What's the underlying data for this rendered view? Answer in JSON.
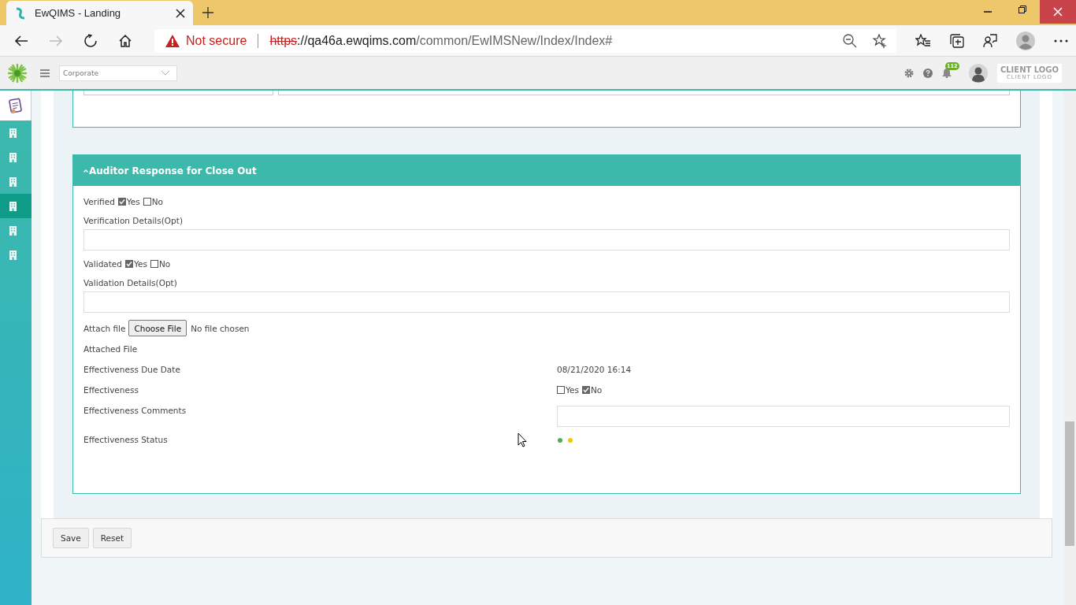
{
  "browser": {
    "tab_title": "EwQIMS - Landing",
    "not_secure": "Not secure",
    "url_scheme": "https",
    "url_host": "://qa46a.ewqims.com",
    "url_path": "/common/EwIMSNew/Index/Index#"
  },
  "app_header": {
    "org_select": "Corporate",
    "notification_count": "112",
    "client_logo": "CLIENT LOGO",
    "client_logo_sub": "CLIENT LOGO"
  },
  "sidebar": {
    "items": [
      {
        "selected": false
      },
      {
        "selected": false
      },
      {
        "selected": false
      },
      {
        "selected": true
      },
      {
        "selected": false
      },
      {
        "selected": false
      }
    ]
  },
  "section": {
    "title": "Auditor Response for Close Out",
    "expanded": true,
    "fields": [
      {
        "kind": "choice",
        "label": "Verified",
        "options": [
          {
            "label": "Yes",
            "checked": true
          },
          {
            "label": "No",
            "checked": false
          }
        ]
      },
      {
        "kind": "textbox",
        "label": "Verification Details(Opt)"
      },
      {
        "kind": "choice",
        "label": "Validated",
        "options": [
          {
            "label": "Yes",
            "checked": true
          },
          {
            "label": "No",
            "checked": false
          }
        ]
      },
      {
        "kind": "textbox",
        "label": "Validation Details(Opt)"
      },
      {
        "kind": "file",
        "label": "Attach file",
        "button": "Choose File",
        "status": "No file chosen"
      },
      {
        "kind": "row",
        "label": "Attached File"
      },
      {
        "kind": "row",
        "label": "Effectiveness Due Date",
        "value": "08/21/2020 16:14"
      },
      {
        "kind": "row_choice",
        "label": "Effectiveness",
        "options": [
          {
            "label": "Yes",
            "checked": false
          },
          {
            "label": "No",
            "checked": true
          }
        ]
      },
      {
        "kind": "row_input",
        "label": "Effectiveness Comments"
      },
      {
        "kind": "row_status",
        "label": "Effectiveness Status",
        "dots": [
          {
            "color": "#4caf50"
          },
          {
            "color": "#f2c600"
          }
        ]
      }
    ]
  },
  "buttons": [
    "Save",
    "Reset"
  ]
}
